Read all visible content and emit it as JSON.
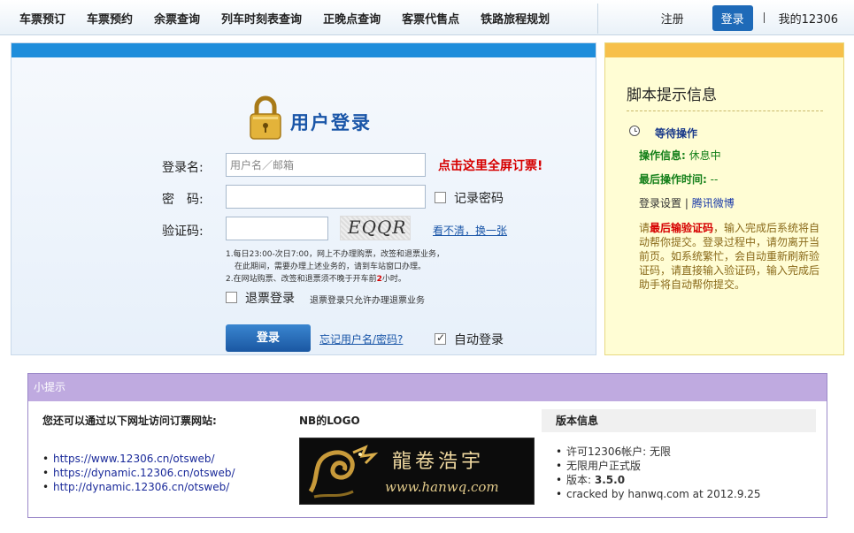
{
  "nav": {
    "items": [
      "车票预订",
      "车票预约",
      "余票查询",
      "列车时刻表查询",
      "正晚点查询",
      "客票代售点",
      "铁路旅程规划"
    ],
    "register": "注册",
    "login": "登录",
    "my12306": "我的12306"
  },
  "login": {
    "title": "用户登录",
    "username_label": "登录名:",
    "username_placeholder": "用户名／邮箱",
    "fullscreen_link": "点击这里全屏订票!",
    "password_label": "密　码:",
    "remember_password": "记录密码",
    "captcha_label": "验证码:",
    "captcha_text": "EQQR",
    "refresh_captcha": "看不清，换一张",
    "notes": {
      "line1": "1.每日23:00-次日7:00，网上不办理购票，改签和退票业务，",
      "line2": "在此期间，需要办理上述业务的，请到车站窗口办理。",
      "line3_prefix": "2.在网站购票、改签和退票须不晚于开车前",
      "line3_hours": "2",
      "line3_suffix": "小时。"
    },
    "refund_login": "退票登录",
    "refund_note": "退票登录只允许办理退票业务",
    "submit": "登录",
    "forgot": "忘记用户名/密码?",
    "auto_login": "自动登录"
  },
  "script": {
    "title": "脚本提示信息",
    "status": "等待操作",
    "op_info_label": "操作信息:",
    "op_info_value": "休息中",
    "last_op_label": "最后操作时间:",
    "last_op_value": "--",
    "settings_link": "登录设置",
    "separator": "|",
    "weibo_link": "腾讯微博",
    "desc_prefix": "请",
    "desc_highlight": "最后输验证码",
    "desc_suffix": "，输入完成后系统将自动帮你提交。登录过程中，请勿离开当前页。如系统繁忙，会自动重新刷新验证码，请直接输入验证码，输入完成后助手将自动帮你提交。"
  },
  "tips": {
    "header": "小提示",
    "col1_title": "您还可以通过以下网址访问订票网站:",
    "urls": [
      "https://www.12306.cn/otsweb/",
      "https://dynamic.12306.cn/otsweb/",
      "http://dynamic.12306.cn/otsweb/"
    ],
    "col2_title": "NB的LOGO",
    "logo_cn": "龍卷浩宇",
    "logo_en": "www.hanwq.com",
    "col3_title": "版本信息",
    "version_items": [
      "许可12306帐户: 无限",
      "无限用户正式版"
    ],
    "version_label": "版本:",
    "version_value": "3.5.0",
    "cracked": "cracked by hanwq.com at 2012.9.25"
  },
  "colors": {
    "accent_blue": "#1e8ddb",
    "nav_login": "#1e6ab8",
    "alert_red": "#d60000",
    "script_bg": "#fffdd4",
    "tips_header": "#bfaae0"
  }
}
